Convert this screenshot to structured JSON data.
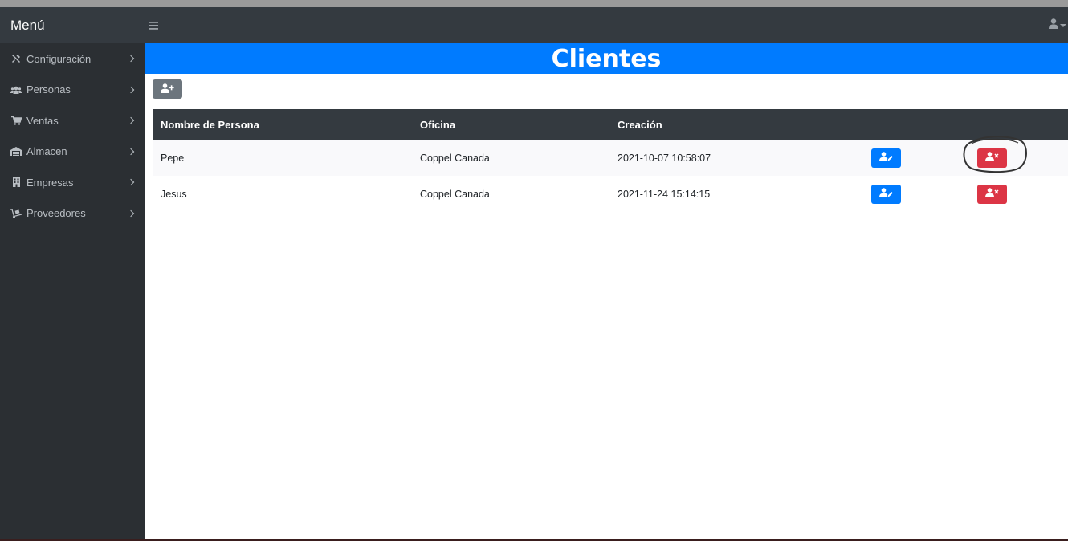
{
  "navbar": {
    "brand": "Menú",
    "menu_icon": "hamburger-icon",
    "user_icon": "user-icon"
  },
  "sidebar": {
    "items": [
      {
        "label": "Configuración",
        "icon": "tools-icon"
      },
      {
        "label": "Personas",
        "icon": "users-icon"
      },
      {
        "label": "Ventas",
        "icon": "cart-icon"
      },
      {
        "label": "Almacen",
        "icon": "warehouse-icon"
      },
      {
        "label": "Empresas",
        "icon": "building-icon"
      },
      {
        "label": "Proveedores",
        "icon": "dolly-icon"
      }
    ]
  },
  "main": {
    "title": "Clientes",
    "add_button_icon": "user-plus-icon",
    "table": {
      "headers": [
        "Nombre de Persona",
        "Oficina",
        "Creación"
      ],
      "rows": [
        {
          "name": "Pepe",
          "office": "Coppel Canada",
          "created": "2021-10-07 10:58:07"
        },
        {
          "name": "Jesus",
          "office": "Coppel Canada",
          "created": "2021-11-24 15:14:15"
        }
      ],
      "edit_icon": "user-edit-icon",
      "delete_icon": "user-times-icon"
    }
  },
  "colors": {
    "navbar": "#343a40",
    "sidebar": "#2b2f33",
    "title_bar": "#007bff",
    "edit": "#007bff",
    "delete": "#dc3545",
    "add": "#6c757d"
  }
}
